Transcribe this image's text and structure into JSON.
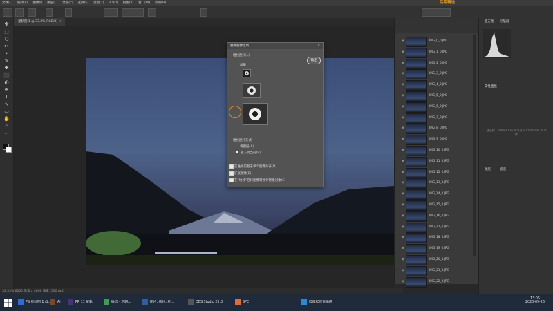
{
  "menu": [
    "文件(F)",
    "编辑(E)",
    "图像(I)",
    "图层(L)",
    "文字(Y)",
    "选择(S)",
    "滤镜(T)",
    "3D(D)",
    "视图(V)",
    "窗口(W)",
    "帮助(H)"
  ],
  "banner_text": "后期精选",
  "document_tab": "星轨图 1 @ 33.3%(RGB/8) ×",
  "status_text": "33.33%   6000 像素 x 4000 像素 (300 ppi)",
  "dialog": {
    "title": "替换图像选项",
    "close": "×",
    "section1": "堆栈图片(L)",
    "group_label": "加载",
    "ok_button": "确定",
    "section2": "堆栈图片方式",
    "option_all": "将图层(A)",
    "option_one": "置入到当前(B)",
    "check1": "在堆栈前基于单个图像对齐(D)",
    "check2": "扩展图像(E)",
    "check3": "在“堆栈”后将图像转换为智能对象(C)"
  },
  "file_list": [
    {
      "name": "IMG_0_0.JPG"
    },
    {
      "name": "IMG_1_0.JPG"
    },
    {
      "name": "IMG_2_0.JPG"
    },
    {
      "name": "IMG_3_0.JPG"
    },
    {
      "name": "IMG_4_0.JPG"
    },
    {
      "name": "IMG_5_0.JPG"
    },
    {
      "name": "IMG_6_0.JPG"
    },
    {
      "name": "IMG_7_0.JPG"
    },
    {
      "name": "IMG_8_0.JPG"
    },
    {
      "name": "IMG_9_0.JPG"
    },
    {
      "name": "IMG_10_0.JPG"
    },
    {
      "name": "IMG_11_0.JPG"
    },
    {
      "name": "IMG_12_0.JPG"
    },
    {
      "name": "IMG_13_0.JPG"
    },
    {
      "name": "IMG_14_0.JPG"
    },
    {
      "name": "IMG_15_0.JPG"
    },
    {
      "name": "IMG_16_0.JPG"
    },
    {
      "name": "IMG_17_0.JPG"
    },
    {
      "name": "IMG_18_0.JPG"
    },
    {
      "name": "IMG_19_0.JPG"
    },
    {
      "name": "IMG_20_0.JPG"
    },
    {
      "name": "IMG_21_0.JPG"
    },
    {
      "name": "IMG_22_0.JPG"
    }
  ],
  "right_panel": {
    "tab1": "直方图",
    "tab2": "导航器",
    "properties_label": "属性面板",
    "cloud_text": "登录到 Creative Cloud 以访问 Creative Cloud 库",
    "layers_tab1": "图层",
    "layers_tab2": "通道"
  },
  "taskbar": {
    "items": [
      {
        "label": "PS 星轨图 1 @..."
      },
      {
        "label": "Ai"
      },
      {
        "label": "PR 11 星轨"
      },
      {
        "label": "微信 - 后期..."
      },
      {
        "label": "图片, 修片, 星..."
      },
      {
        "label": "OBS Studio 25.0"
      },
      {
        "label": "SPE"
      },
      {
        "label": "哔哩哔哩直播姬"
      }
    ],
    "time": "13:06",
    "date": "2020-09-26"
  },
  "colors": {
    "accent": "#e39a2a",
    "highlight_circle": "#e58a2e",
    "taskbar": "#1f2a3a"
  }
}
